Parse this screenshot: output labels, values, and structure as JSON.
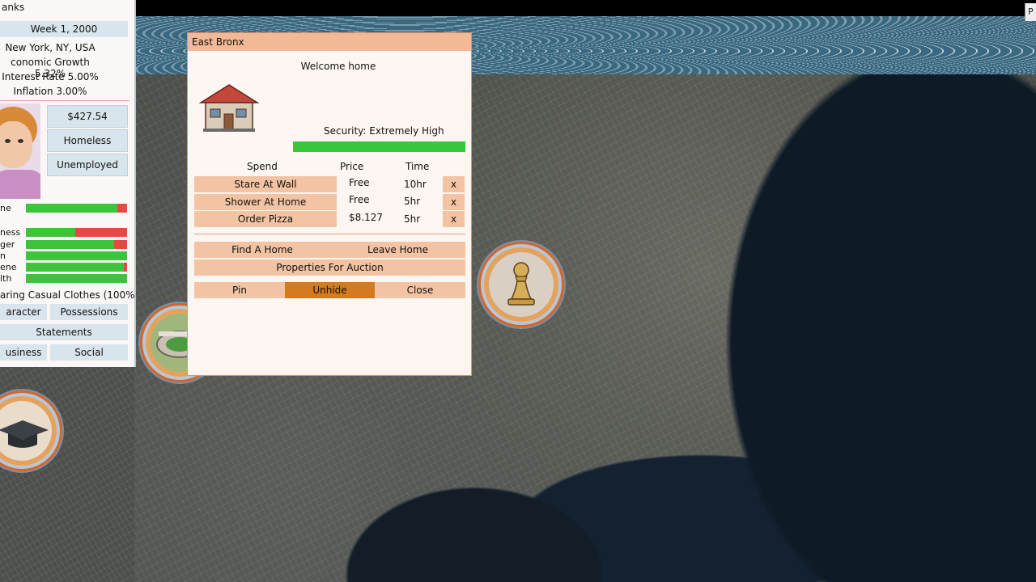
{
  "top_right_tab": "P",
  "side_panel": {
    "title": "anks",
    "week": "Week 1, 2000",
    "location": "New York, NY, USA",
    "economic_growth": "conomic Growth 5.32%",
    "interest_rate": "Interest Rate 5.00%",
    "inflation": "Inflation 3.00%",
    "money": "$427.54",
    "housing": "Homeless",
    "job": "Unemployed",
    "stats": [
      {
        "label": "ne",
        "value": 0.9
      },
      {
        "label": "ness",
        "value": 0.49
      },
      {
        "label": "ger",
        "value": 0.87
      },
      {
        "label": "n",
        "value": 1.0
      },
      {
        "label": "ene",
        "value": 0.97
      },
      {
        "label": "lth",
        "value": 1.0
      }
    ],
    "wearing": "aring Casual Clothes (100%)",
    "buttons": {
      "character": "aracter",
      "possessions": "Possessions",
      "statements": "Statements",
      "business": "usiness",
      "social": "Social"
    }
  },
  "dialog": {
    "title": "East Bronx",
    "welcome": "Welcome home",
    "security": "Security: Extremely High",
    "security_level": 1.0,
    "col_spend": "Spend",
    "col_price": "Price",
    "col_time": "Time",
    "actions": [
      {
        "label": "Stare At Wall",
        "price": "Free",
        "time": "10hr",
        "remove": "x"
      },
      {
        "label": "Shower At Home",
        "price": "Free",
        "time": "5hr",
        "remove": "x"
      },
      {
        "label": "Order Pizza",
        "price": "$8.127",
        "time": "5hr",
        "remove": "x"
      }
    ],
    "find_home": "Find A Home",
    "leave_home": "Leave Home",
    "properties_auction": "Properties For Auction",
    "pin": "Pin",
    "unhide": "Unhide",
    "close": "Close"
  }
}
